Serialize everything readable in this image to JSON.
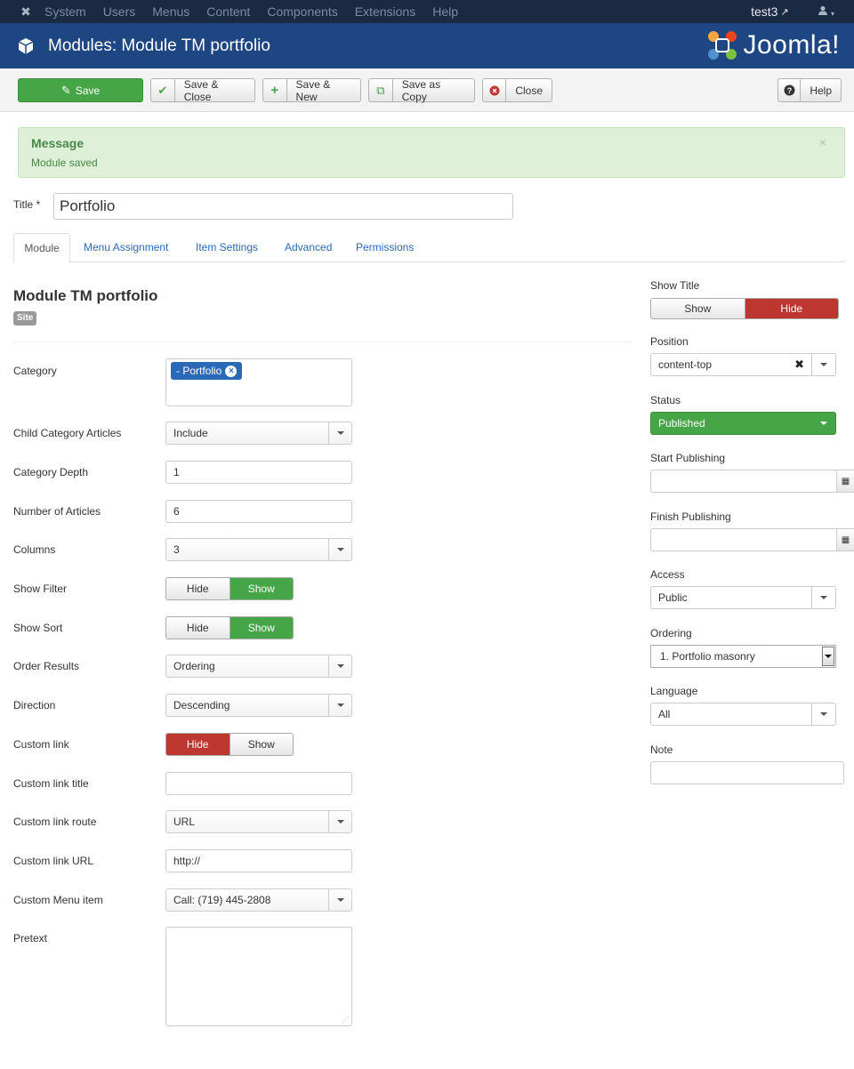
{
  "topnav": {
    "menu": [
      "System",
      "Users",
      "Menus",
      "Content",
      "Components",
      "Extensions",
      "Help"
    ],
    "user": "test3"
  },
  "header": {
    "title": "Modules: Module TM portfolio",
    "brand": "Joomla!"
  },
  "toolbar": {
    "save": "Save",
    "save_close": "Save & Close",
    "save_new": "Save & New",
    "save_copy": "Save as Copy",
    "close": "Close",
    "help": "Help"
  },
  "message": {
    "heading": "Message",
    "text": "Module saved",
    "close": "×"
  },
  "title_field": {
    "label": "Title *",
    "value": "Portfolio"
  },
  "tabs": [
    "Module",
    "Menu Assignment",
    "Item Settings",
    "Advanced",
    "Permissions"
  ],
  "module": {
    "title": "Module TM portfolio",
    "badge": "Site"
  },
  "form": {
    "category": {
      "label": "Category",
      "chip": "- Portfolio"
    },
    "child_category": {
      "label": "Child Category Articles",
      "value": "Include"
    },
    "category_depth": {
      "label": "Category Depth",
      "value": "1"
    },
    "number_articles": {
      "label": "Number of Articles",
      "value": "6"
    },
    "columns": {
      "label": "Columns",
      "value": "3"
    },
    "show_filter": {
      "label": "Show Filter",
      "off": "Hide",
      "on": "Show"
    },
    "show_sort": {
      "label": "Show Sort",
      "off": "Hide",
      "on": "Show"
    },
    "order_results": {
      "label": "Order Results",
      "value": "Ordering"
    },
    "direction": {
      "label": "Direction",
      "value": "Descending"
    },
    "custom_link": {
      "label": "Custom link",
      "off": "Hide",
      "on": "Show"
    },
    "custom_link_title": {
      "label": "Custom link title",
      "value": ""
    },
    "custom_link_route": {
      "label": "Custom link route",
      "value": "URL"
    },
    "custom_link_url": {
      "label": "Custom link URL",
      "value": "http://"
    },
    "custom_menu_item": {
      "label": "Custom Menu item",
      "value": "Call: (719) 445-2808"
    },
    "pretext": {
      "label": "Pretext",
      "value": ""
    }
  },
  "sidebar": {
    "show_title": {
      "label": "Show Title",
      "show": "Show",
      "hide": "Hide"
    },
    "position": {
      "label": "Position",
      "value": "content-top"
    },
    "status": {
      "label": "Status",
      "value": "Published"
    },
    "start_publishing": {
      "label": "Start Publishing",
      "value": ""
    },
    "finish_publishing": {
      "label": "Finish Publishing",
      "value": ""
    },
    "access": {
      "label": "Access",
      "value": "Public"
    },
    "ordering": {
      "label": "Ordering",
      "value": "1. Portfolio masonry"
    },
    "language": {
      "label": "Language",
      "value": "All"
    },
    "note": {
      "label": "Note",
      "value": ""
    }
  },
  "colors": {
    "topnav": "#1b2a43",
    "header": "#1d4682",
    "green": "#46a546",
    "red": "#bd362f",
    "link": "#2a69b8"
  }
}
